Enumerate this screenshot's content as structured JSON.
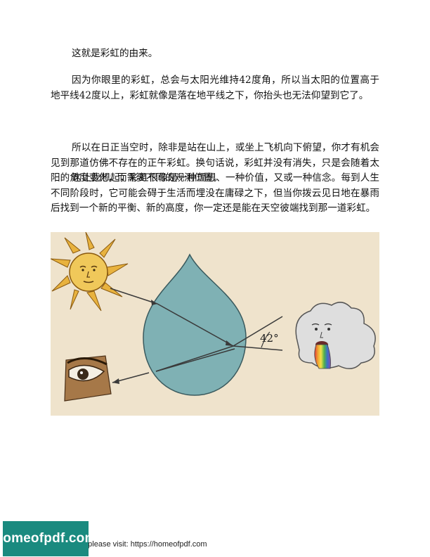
{
  "document": {
    "paragraphs": [
      "这就是彩虹的由来。",
      "因为你眼里的彩虹，总会与太阳光维持42度角，所以当太阳的位置高于地平线42度以上，彩虹就像是落在地平线之下，你抬头也无法仰望到它了。",
      "所以在日正当空时，除非是站在山上，或坐上飞机向下俯望，你才有机会见到那道仿佛不存在的正午彩虹。换句话说，彩虹并没有消失，只是会随着太阳的角度变化，而需要不同的观测位置。",
      "这让我想起，彩虹很像是一种理想、一种价值，又或一种信念。每到人生不同阶段时，它可能会碍于生活而埋没在庸碌之下，但当你拨云见日地在暴雨后找到一个新的平衡、新的高度，你一定还是能在天空彼端找到那一道彩虹。"
    ]
  },
  "figure": {
    "angle_label": "42°",
    "icons": [
      "sun-icon",
      "water-drop-icon",
      "eye-icon",
      "cloud-face-icon"
    ],
    "colors": {
      "background": "#efe3cc",
      "drop": "#7fb1b4",
      "sun": "#e6b84a",
      "cloud": "#dedede"
    }
  },
  "footer": {
    "logo_text": "homeofpdf.com",
    "note": "e please visit: https://homeofpdf.com"
  }
}
